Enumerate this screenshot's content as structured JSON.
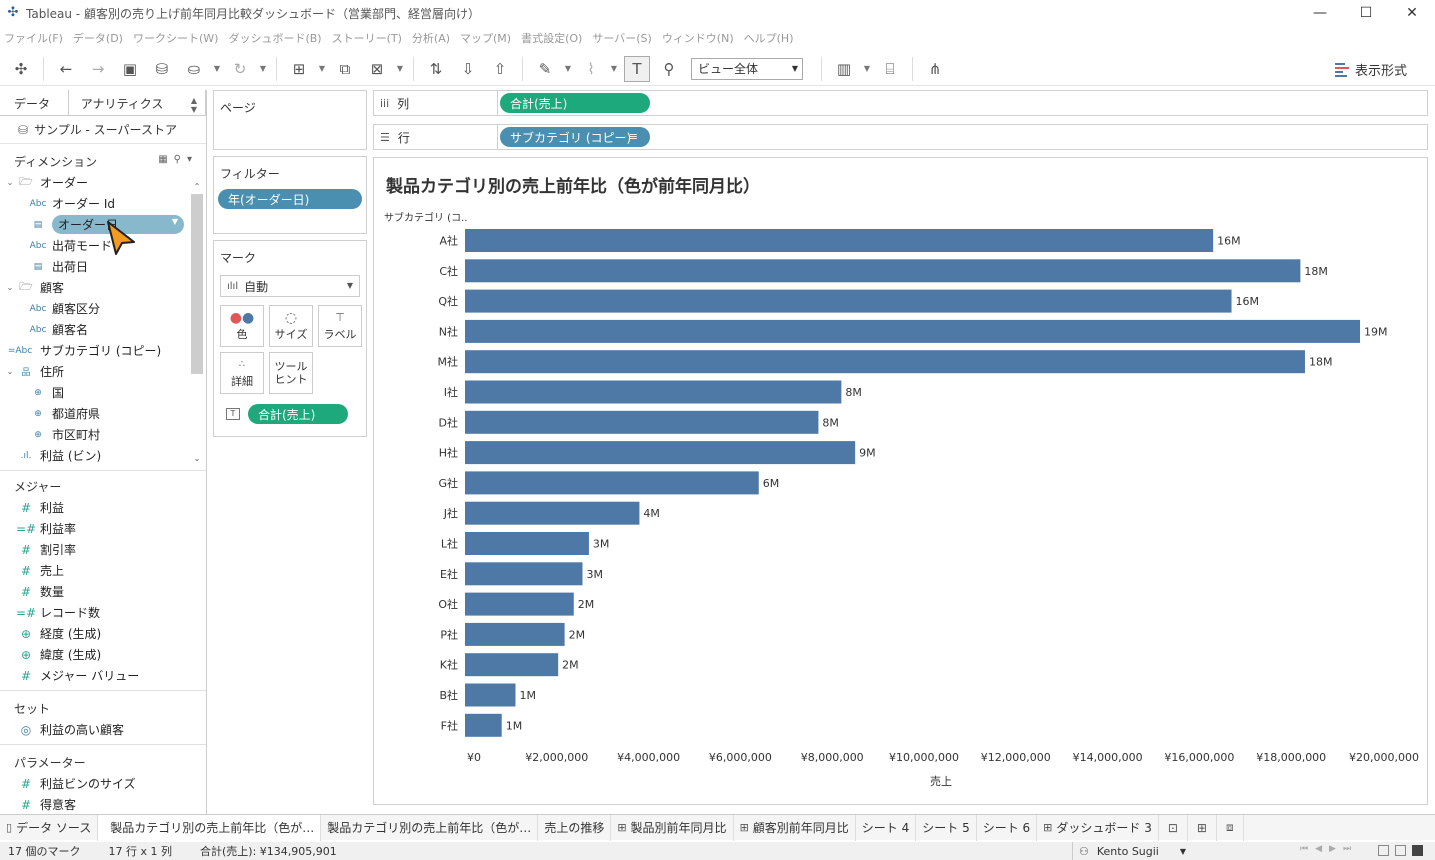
{
  "window": {
    "title": "Tableau - 顧客別の売り上げ前年同月比較ダッシュボード（営業部門、経営層向け）",
    "controls": [
      "—",
      "☐",
      "✕"
    ]
  },
  "menu": [
    "ファイル(F)",
    "データ(D)",
    "ワークシート(W)",
    "ダッシュボード(B)",
    "ストーリー(T)",
    "分析(A)",
    "マップ(M)",
    "書式設定(O)",
    "サーバー(S)",
    "ウィンドウ(N)",
    "ヘルプ(H)"
  ],
  "toolbar": {
    "view_select": "ビュー全体",
    "show_me": "表示形式"
  },
  "data_pane": {
    "tab_data": "データ",
    "tab_analytics": "アナリティクス",
    "datasource": "サンプル - スーパーストア",
    "dimensions_header": "ディメンション",
    "dimensions": [
      {
        "label": "オーダー",
        "type": "folder",
        "level": 0
      },
      {
        "label": "オーダー Id",
        "type": "Abc",
        "level": 1
      },
      {
        "label": "オーダー日",
        "type": "date",
        "level": 1,
        "highlight": true
      },
      {
        "label": "出荷モード",
        "type": "Abc",
        "level": 1
      },
      {
        "label": "出荷日",
        "type": "date",
        "level": 1
      },
      {
        "label": "顧客",
        "type": "folder",
        "level": 0
      },
      {
        "label": "顧客区分",
        "type": "Abc",
        "level": 1
      },
      {
        "label": "顧客名",
        "type": "Abc",
        "level": 1
      },
      {
        "label": "サブカテゴリ (コピー)",
        "type": "=Abc",
        "level": 0
      },
      {
        "label": "住所",
        "type": "hier",
        "level": 0
      },
      {
        "label": "国",
        "type": "geo",
        "level": 1
      },
      {
        "label": "都道府県",
        "type": "geo",
        "level": 1
      },
      {
        "label": "市区町村",
        "type": "geo",
        "level": 1
      },
      {
        "label": "利益 (ビン)",
        "type": "bin",
        "level": 0
      }
    ],
    "measures_header": "メジャー",
    "measures": [
      {
        "label": "利益",
        "type": "#"
      },
      {
        "label": "利益率",
        "type": "=#"
      },
      {
        "label": "割引率",
        "type": "#"
      },
      {
        "label": "売上",
        "type": "#"
      },
      {
        "label": "数量",
        "type": "#"
      },
      {
        "label": "レコード数",
        "type": "=#"
      },
      {
        "label": "経度 (生成)",
        "type": "geo"
      },
      {
        "label": "緯度 (生成)",
        "type": "geo"
      },
      {
        "label": "メジャー バリュー",
        "type": "#"
      }
    ],
    "sets_header": "セット",
    "sets": [
      {
        "label": "利益の高い顧客"
      }
    ],
    "params_header": "パラメーター",
    "params": [
      {
        "label": "利益ビンのサイズ"
      },
      {
        "label": "得意客"
      }
    ]
  },
  "shelves": {
    "pages_title": "ページ",
    "filters_title": "フィルター",
    "filter_pill": "年(オーダー日)",
    "marks_title": "マーク",
    "marks_type": "自動",
    "mark_buttons": [
      {
        "label": "色",
        "icon": "color-icon"
      },
      {
        "label": "サイズ",
        "icon": "size-icon"
      },
      {
        "label": "ラベル",
        "icon": "label-icon"
      },
      {
        "label": "詳細",
        "icon": "detail-icon"
      },
      {
        "label": "ツール\nヒント",
        "icon": "tooltip-icon"
      }
    ],
    "marks_pill": "合計(売上)",
    "columns_label": "列",
    "columns_pill": "合計(売上)",
    "rows_label": "行",
    "rows_pill": "サブカテゴリ (コピー)"
  },
  "worksheet": {
    "title": "製品カテゴリ別の売上前年比（色が前年同月比）",
    "bar_color": "#4e79a7"
  },
  "chart_data": {
    "type": "bar",
    "orientation": "horizontal",
    "title": "製品カテゴリ別の売上前年比（色が前年同月比）",
    "row_header": "サブカテゴリ (コ..",
    "xlabel": "売上",
    "categories": [
      "A社",
      "C社",
      "Q社",
      "N社",
      "M社",
      "I社",
      "D社",
      "H社",
      "G社",
      "J社",
      "L社",
      "E社",
      "O社",
      "P社",
      "K社",
      "B社",
      "F社"
    ],
    "values": [
      16300000,
      18200000,
      16700000,
      19500000,
      18300000,
      8200000,
      7700000,
      8500000,
      6400000,
      3800000,
      2700000,
      2560000,
      2370000,
      2170000,
      2030000,
      1100000,
      800000
    ],
    "data_labels": [
      "16M",
      "18M",
      "16M",
      "19M",
      "18M",
      "8M",
      "8M",
      "9M",
      "6M",
      "4M",
      "3M",
      "3M",
      "2M",
      "2M",
      "2M",
      "1M",
      "1M"
    ],
    "xlim": [
      0,
      20000000
    ],
    "xticks": [
      0,
      2000000,
      4000000,
      6000000,
      8000000,
      10000000,
      12000000,
      14000000,
      16000000,
      18000000,
      20000000
    ],
    "xtick_labels": [
      "¥0",
      "¥2,000,000",
      "¥4,000,000",
      "¥6,000,000",
      "¥8,000,000",
      "¥10,000,000",
      "¥12,000,000",
      "¥14,000,000",
      "¥16,000,000",
      "¥18,000,000",
      "¥20,000,000"
    ],
    "grid": false,
    "color": "#4e79a7"
  },
  "sheet_tabs": [
    {
      "label": "データ ソース",
      "kind": "datasource"
    },
    {
      "label": "製品カテゴリ別の売上前年比（色が…",
      "kind": "sheet",
      "active": true
    },
    {
      "label": "製品カテゴリ別の売上前年比（色が…",
      "kind": "sheet"
    },
    {
      "label": "売上の推移",
      "kind": "sheet"
    },
    {
      "label": "製品別前年同月比",
      "kind": "dashboard"
    },
    {
      "label": "顧客別前年同月比",
      "kind": "dashboard"
    },
    {
      "label": "シート 4",
      "kind": "sheet"
    },
    {
      "label": "シート 5",
      "kind": "sheet"
    },
    {
      "label": "シート 6",
      "kind": "sheet"
    },
    {
      "label": "ダッシュボード 3",
      "kind": "dashboard"
    }
  ],
  "status": {
    "marks": "17 個のマーク",
    "dims": "17 行 x 1 列",
    "sum": "合計(売上): ¥134,905,901",
    "user": "Kento Sugii"
  }
}
